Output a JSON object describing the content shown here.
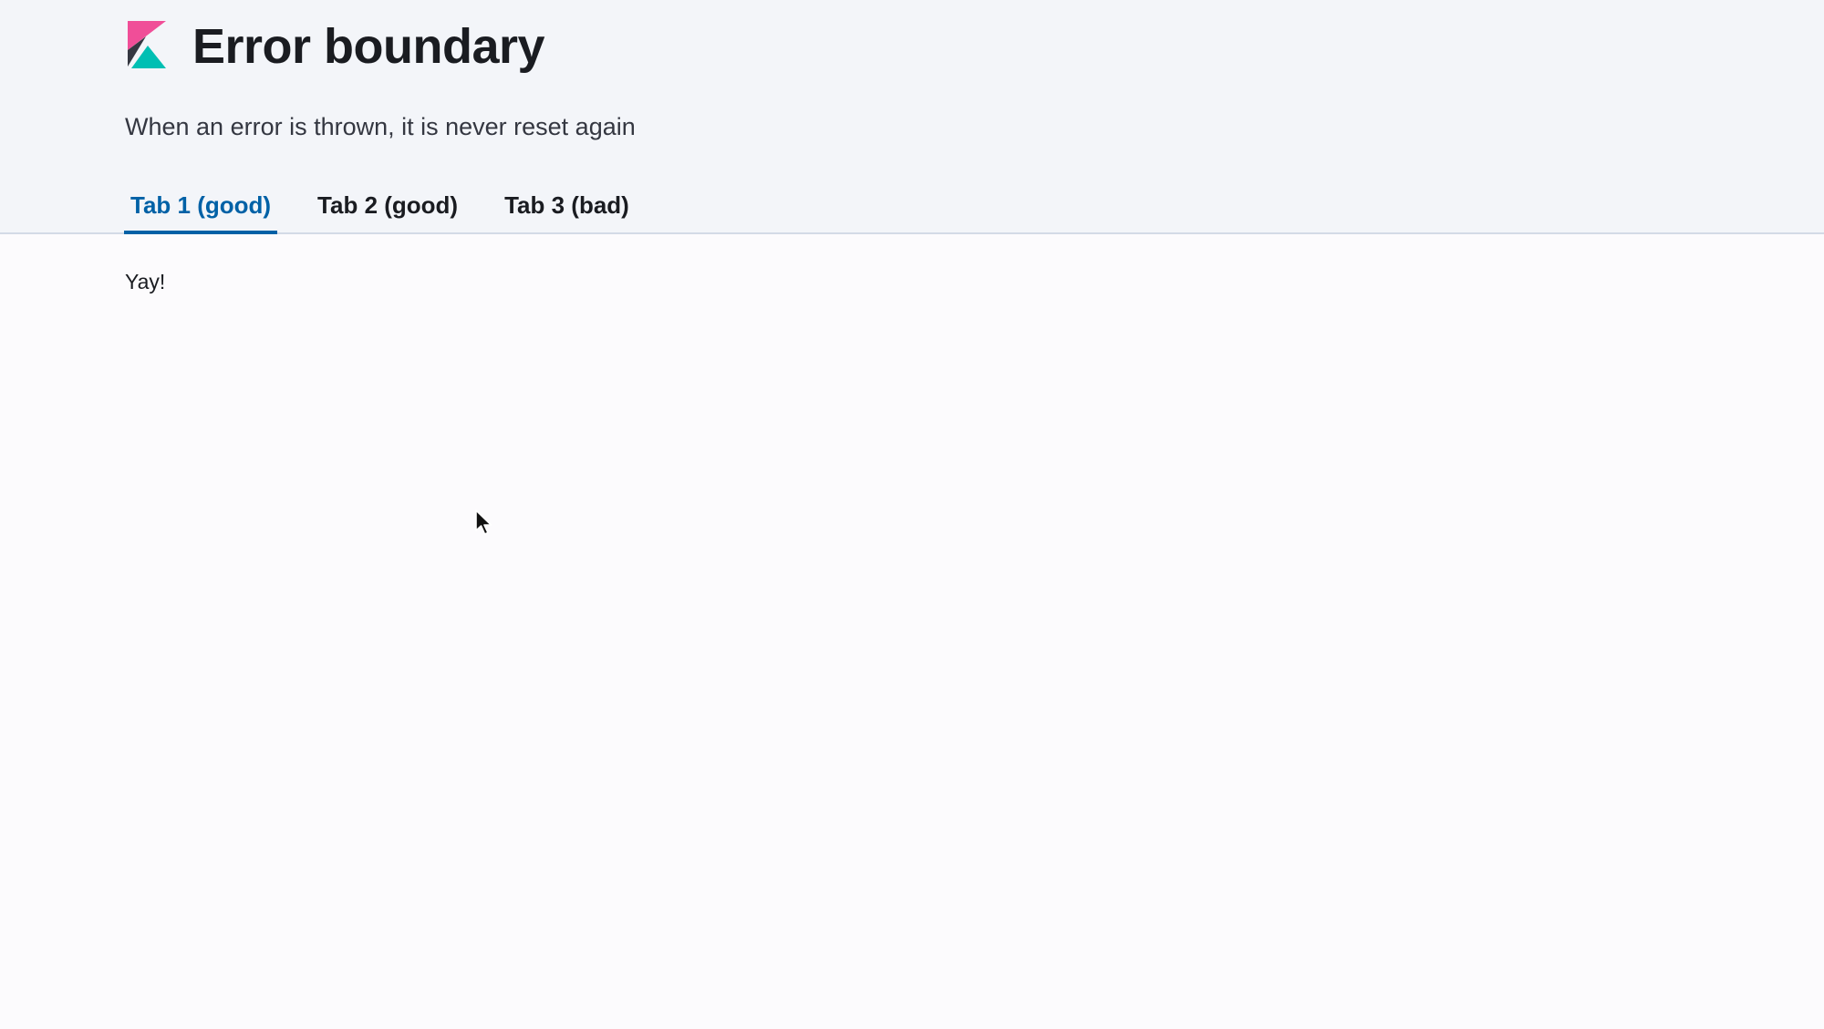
{
  "header": {
    "logo_icon": "kibana-logo-icon",
    "title": "Error boundary",
    "description": "When an error is thrown, it is never reset again"
  },
  "tabs": [
    {
      "label": "Tab 1 (good)",
      "selected": true
    },
    {
      "label": "Tab 2 (good)",
      "selected": false
    },
    {
      "label": "Tab 3 (bad)",
      "selected": false
    }
  ],
  "content": {
    "text": "Yay!"
  },
  "colors": {
    "accent": "#0061a6",
    "header_background": "#f3f5f9",
    "logo_pink": "#f04e98",
    "logo_teal": "#00bfb3",
    "logo_dark": "#343741"
  },
  "cursor_icon": "mouse-pointer-icon"
}
